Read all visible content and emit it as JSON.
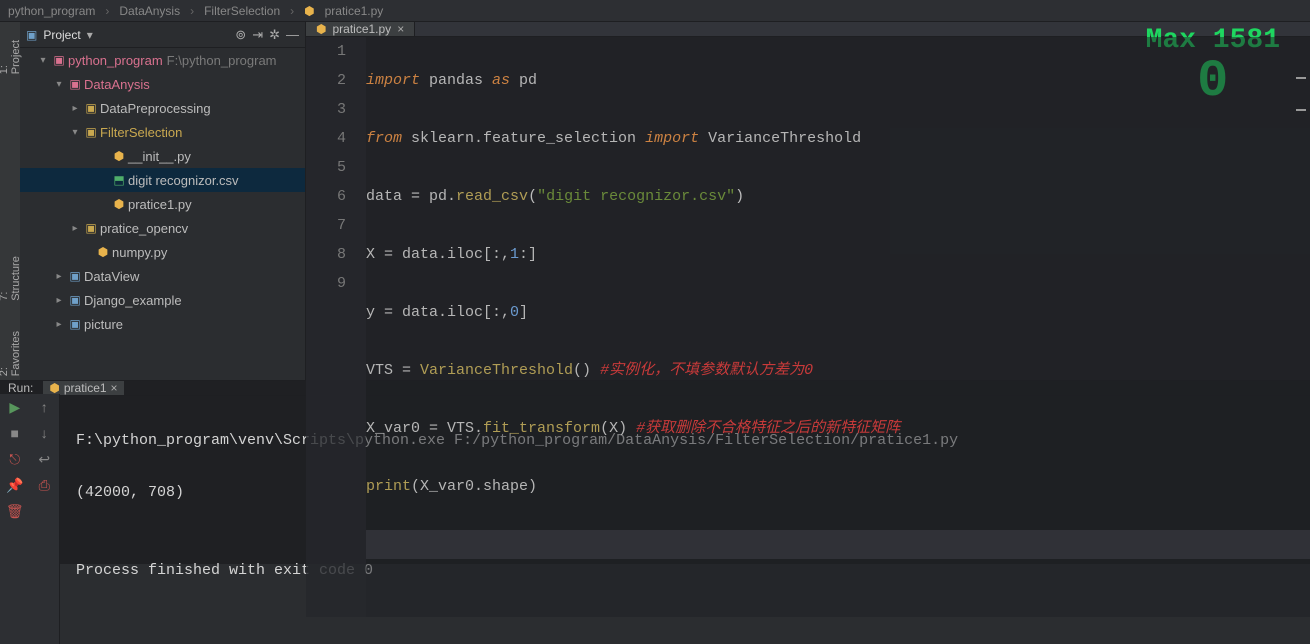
{
  "breadcrumb": {
    "item1": "python_program",
    "item2": "DataAnysis",
    "item3": "FilterSelection",
    "item4": "pratice1.py"
  },
  "panel": {
    "title": "Project"
  },
  "tree": {
    "root": "python_program",
    "root_path": "F:\\python_program",
    "n1": "DataAnysis",
    "n2": "DataPreprocessing",
    "n3": "FilterSelection",
    "n3a": "__init__.py",
    "n3b": "digit recognizor.csv",
    "n3c": "pratice1.py",
    "n4": "pratice_opencv",
    "n5": "numpy.py",
    "n6": "DataView",
    "n7": "Django_example",
    "n8": "picture"
  },
  "tab": {
    "name": "pratice1.py"
  },
  "fpm": {
    "top": "Max 1581",
    "big": "0"
  },
  "code": {
    "l1_kw1": "import",
    "l1_id": " pandas ",
    "l1_kw2": "as",
    "l1_al": " pd",
    "l2_kw1": "from",
    "l2_mod": " sklearn.feature_selection ",
    "l2_kw2": "import",
    "l2_cls": " VarianceThreshold",
    "l3_a": "data ",
    "l3_eq": "=",
    "l3_b": " pd.",
    "l3_fn": "read_csv",
    "l3_p": "(",
    "l3_s": "\"digit recognizor.csv\"",
    "l3_c": ")",
    "l4": "X = data.iloc[:,",
    "l4_num": "1",
    "l4_b": ":]",
    "l5": "y = data.iloc[:,",
    "l5_num": "0",
    "l5_b": "]",
    "l6_a": "VTS = ",
    "l6_fn": "VarianceThreshold",
    "l6_b": "() ",
    "l6_cmt": "#实例化，不填参数默认方差为0",
    "l7_a": "X_var0 = VTS.",
    "l7_fn": "fit_transform",
    "l7_b": "(X) ",
    "l7_cmt": "#获取删除不合格特征之后的新特征矩阵",
    "l8_fn": "print",
    "l8_b": "(X_var0.shape)"
  },
  "gutter": [
    "1",
    "2",
    "3",
    "4",
    "5",
    "6",
    "7",
    "8",
    "9"
  ],
  "run": {
    "label": "Run:",
    "tabname": "pratice1",
    "line1": "F:\\python_program\\venv\\Scripts\\python.exe F:/python_program/DataAnysis/FilterSelection/pratice1.py",
    "line2": "(42000, 708)",
    "line3": "",
    "line4": "Process finished with exit code 0"
  },
  "sidetabs": {
    "project": "1: Project",
    "structure": "7: Structure",
    "fav": "2: Favorites"
  }
}
